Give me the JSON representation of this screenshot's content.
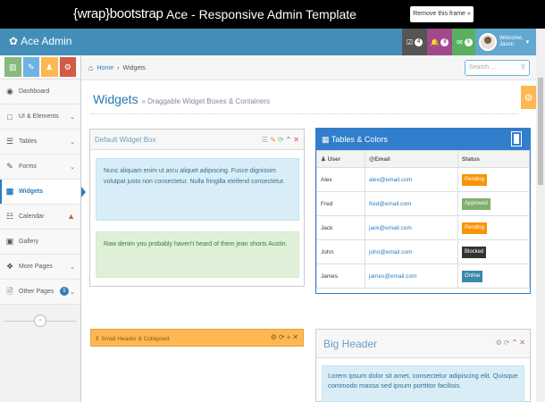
{
  "wrapbar": {
    "logo": "{wrap}bootstrap",
    "title": "Ace - Responsive Admin Template",
    "remove_button": "Remove this frame »"
  },
  "navbar": {
    "brand": "Ace Admin",
    "badges": [
      {
        "icon": "tasks-icon",
        "count": "4",
        "color": "#555555"
      },
      {
        "icon": "bell-icon",
        "count": "8",
        "color": "#a0498d"
      },
      {
        "icon": "envelope-icon",
        "count": "5",
        "color": "#6fb3e0"
      }
    ],
    "welcome": "Welcome,",
    "user": "Jason"
  },
  "sidebar": {
    "shortcuts": [
      {
        "icon": "chart-icon",
        "color": "#87b87f"
      },
      {
        "icon": "pencil-icon",
        "color": "#6fb3e0"
      },
      {
        "icon": "users-icon",
        "color": "#ffb752"
      },
      {
        "icon": "cogs-icon",
        "color": "#d15b47"
      }
    ],
    "items": [
      {
        "label": "Dashboard",
        "icon": "dashboard-icon"
      },
      {
        "label": "UI & Elements",
        "icon": "desktop-icon"
      },
      {
        "label": "Tables",
        "icon": "list-icon"
      },
      {
        "label": "Forms",
        "icon": "edit-icon"
      },
      {
        "label": "Widgets",
        "icon": "widgets-icon"
      },
      {
        "label": "Calendar",
        "icon": "calendar-icon"
      },
      {
        "label": "Gallery",
        "icon": "picture-icon"
      },
      {
        "label": "More Pages",
        "icon": "tag-icon"
      },
      {
        "label": "Other Pages",
        "icon": "file-icon",
        "badge": "5"
      }
    ]
  },
  "breadcrumb": {
    "home": "Home",
    "current": "Widgets"
  },
  "search": {
    "placeholder": "Search ..."
  },
  "page": {
    "title": "Widgets",
    "subtitle": "» Draggable Widget Boxes & Containers"
  },
  "default_widget": {
    "title": "Default Widget Box",
    "info_text": "Nunc aliquam enim ut arcu aliquet adipiscing. Fusce dignissim volutpat justo non consectetur. Nulla fringilla eleifend consectetur.",
    "success_text": "Raw denim you probably haven't heard of them jean shorts Austin."
  },
  "table_widget": {
    "title": "Tables & Colors",
    "headers": [
      "User",
      "Email",
      "Status"
    ],
    "rows": [
      {
        "user": "Alex",
        "email": "alex@email.com",
        "status": "Pending",
        "color": "#f89406"
      },
      {
        "user": "Fred",
        "email": "fred@email.com",
        "status": "Approved",
        "color": "#82af6f"
      },
      {
        "user": "Jack",
        "email": "jack@email.com",
        "status": "Pending",
        "color": "#f89406"
      },
      {
        "user": "John",
        "email": "john@email.com",
        "status": "Blocked",
        "color": "#333333"
      },
      {
        "user": "James",
        "email": "james@email.com",
        "status": "Online",
        "color": "#3a87ad"
      }
    ]
  },
  "small_header": {
    "title": "Small Header & Collapsed"
  },
  "big_header": {
    "title": "Big Header",
    "text": "Lorem ipsum dolor sit amet, consectetur adipiscing elit. Quisque commodo massa sed ipsum porttitor facilisis."
  }
}
